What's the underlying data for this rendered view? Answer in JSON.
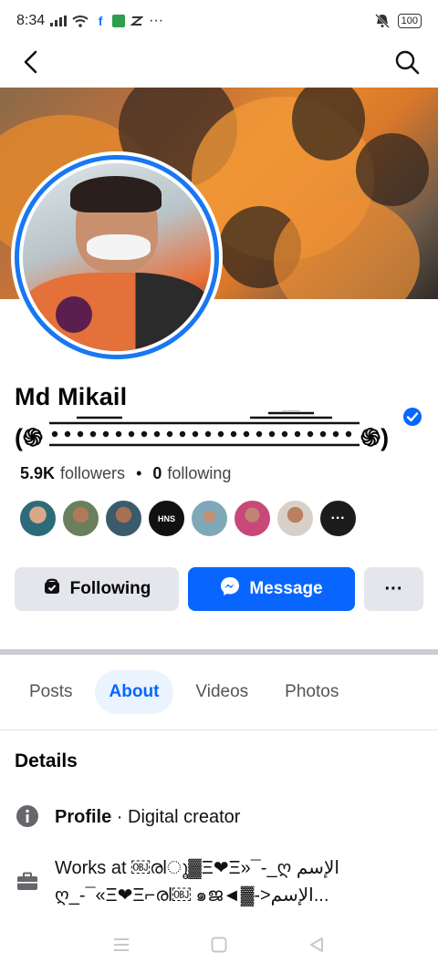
{
  "status_bar": {
    "time": "8:34",
    "signal_icon": "signal-icon",
    "wifi_icon": "wifi-icon",
    "notification_icons": [
      "facebook-icon",
      "app-icon",
      "mail-icon"
    ],
    "overflow": "···",
    "silent_icon": "bell-mute-icon",
    "battery": "100"
  },
  "nav": {
    "back_icon": "chevron-left-icon",
    "search_icon": "search-icon"
  },
  "profile": {
    "name_line1": "Md Mikail",
    "name_line2_start": "(",
    "name_line2_glyph": "֍",
    "name_line2_end": ")",
    "verified_icon": "verified-badge-icon",
    "followers_count": "5.9K",
    "followers_label": "followers",
    "separator": "•",
    "following_count": "0",
    "following_label": "following"
  },
  "friends_more_label": "···",
  "actions": {
    "following_label": "Following",
    "message_label": "Message",
    "more_label": "···"
  },
  "tabs": [
    {
      "label": "Posts",
      "active": false
    },
    {
      "label": "About",
      "active": true
    },
    {
      "label": "Videos",
      "active": false
    },
    {
      "label": "Photos",
      "active": false
    }
  ],
  "details": {
    "heading": "Details",
    "profile_label": "Profile",
    "profile_value": " · Digital creator",
    "works_line1": "Works at ￼രlൂ▓Ξ❤Ξ»¯-_ღ الإسم",
    "works_line2": "ღ_-¯«Ξ❤Ξ⌐രl￼ ๑ജ◄▓->الإسم..."
  },
  "colors": {
    "accent": "#0866ff",
    "ring": "#1877f2",
    "button_gray": "#e4e6eb",
    "active_tab_bg": "#ebf3ff"
  }
}
